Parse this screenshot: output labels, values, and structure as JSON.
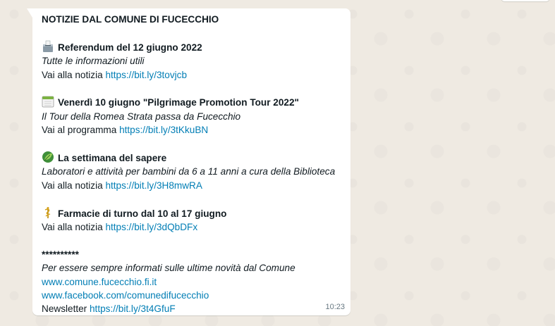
{
  "message": {
    "header": "NOTIZIE DAL COMUNE DI FUCECCHIO",
    "items": [
      {
        "icon": "ballot-box-icon",
        "title": "Referendum del 12 giugno 2022",
        "subtitle": "Tutte le informazioni utili",
        "cta": "Vai alla notizia",
        "link": "https://bit.ly/3tovjcb"
      },
      {
        "icon": "calendar-icon",
        "title": "Venerdì 10 giugno \"Pilgrimage Promotion Tour 2022\"",
        "subtitle": "Il Tour della Romea Strata passa da Fucecchio",
        "cta": "Vai al programma",
        "link": "https://bit.ly/3tKkuBN"
      },
      {
        "icon": "leaf-icon",
        "title": "La settimana del sapere",
        "subtitle": "Laboratori e attività per bambini da 6 a 11 anni a cura della Biblioteca",
        "cta": "Vai alla notizia",
        "link": "https://bit.ly/3H8mwRA"
      },
      {
        "icon": "caduceus-icon",
        "title": "Farmacie di turno dal 10 al 17 giugno",
        "cta": "Vai alla notizia",
        "link": "https://bit.ly/3dQbDFx"
      }
    ],
    "separator": "**********",
    "footer_note": "Per essere sempre informati sulle ultime novità dal Comune",
    "footer_site": "www.comune.fucecchio.fi.it",
    "footer_facebook": "www.facebook.com/comunedifucecchio",
    "footer_newsletter_label": "Newsletter",
    "footer_newsletter_link": "https://bit.ly/3t4GfuF",
    "time": "10:23"
  },
  "colors": {
    "chat_background": "#efeae2",
    "bubble": "#ffffff",
    "link": "#027eb5",
    "text": "#111b21",
    "timestamp": "#667781"
  }
}
